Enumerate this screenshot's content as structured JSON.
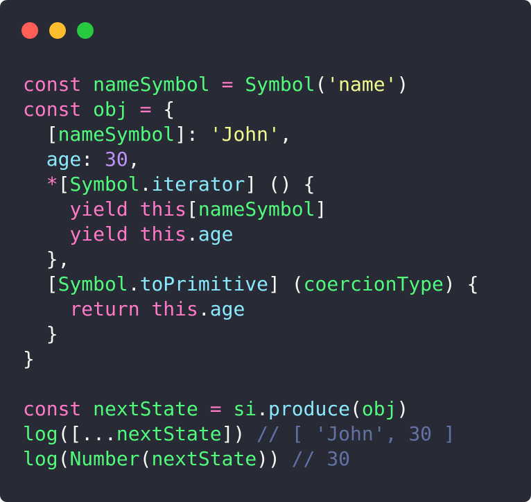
{
  "window": {
    "buttons": [
      {
        "name": "close",
        "color": "#ff5f56"
      },
      {
        "name": "minimize",
        "color": "#ffbd2e"
      },
      {
        "name": "maximize",
        "color": "#27c93f"
      }
    ]
  },
  "colors": {
    "background": "#282a36",
    "plain": "#f8f8f2",
    "keyword": "#ff79c6",
    "function": "#50fa7b",
    "string": "#f1fa8c",
    "property": "#8be9fd",
    "number": "#bd93f9",
    "comment": "#6272a4"
  },
  "code": [
    [
      [
        "keyword",
        "const"
      ],
      [
        "plain",
        " "
      ],
      [
        "function",
        "nameSymbol"
      ],
      [
        "plain",
        " "
      ],
      [
        "keyword",
        "="
      ],
      [
        "plain",
        " "
      ],
      [
        "function",
        "Symbol"
      ],
      [
        "plain",
        "("
      ],
      [
        "string",
        "'name'"
      ],
      [
        "plain",
        ")"
      ]
    ],
    [
      [
        "keyword",
        "const"
      ],
      [
        "plain",
        " "
      ],
      [
        "function",
        "obj"
      ],
      [
        "plain",
        " "
      ],
      [
        "keyword",
        "="
      ],
      [
        "plain",
        " {"
      ]
    ],
    [
      [
        "plain",
        "  ["
      ],
      [
        "function",
        "nameSymbol"
      ],
      [
        "plain",
        "]: "
      ],
      [
        "string",
        "'John'"
      ],
      [
        "plain",
        ","
      ]
    ],
    [
      [
        "plain",
        "  "
      ],
      [
        "property",
        "age"
      ],
      [
        "plain",
        ": "
      ],
      [
        "number",
        "30"
      ],
      [
        "plain",
        ","
      ]
    ],
    [
      [
        "plain",
        "  "
      ],
      [
        "keyword",
        "*"
      ],
      [
        "plain",
        "["
      ],
      [
        "function",
        "Symbol"
      ],
      [
        "plain",
        "."
      ],
      [
        "property",
        "iterator"
      ],
      [
        "plain",
        "] () {"
      ]
    ],
    [
      [
        "plain",
        "    "
      ],
      [
        "keyword",
        "yield"
      ],
      [
        "plain",
        " "
      ],
      [
        "keyword",
        "this"
      ],
      [
        "plain",
        "["
      ],
      [
        "function",
        "nameSymbol"
      ],
      [
        "plain",
        "]"
      ]
    ],
    [
      [
        "plain",
        "    "
      ],
      [
        "keyword",
        "yield"
      ],
      [
        "plain",
        " "
      ],
      [
        "keyword",
        "this"
      ],
      [
        "plain",
        "."
      ],
      [
        "property",
        "age"
      ]
    ],
    [
      [
        "plain",
        "  },"
      ]
    ],
    [
      [
        "plain",
        "  ["
      ],
      [
        "function",
        "Symbol"
      ],
      [
        "plain",
        "."
      ],
      [
        "property",
        "toPrimitive"
      ],
      [
        "plain",
        "] ("
      ],
      [
        "function",
        "coercionType"
      ],
      [
        "plain",
        ") {"
      ]
    ],
    [
      [
        "plain",
        "    "
      ],
      [
        "keyword",
        "return"
      ],
      [
        "plain",
        " "
      ],
      [
        "keyword",
        "this"
      ],
      [
        "plain",
        "."
      ],
      [
        "property",
        "age"
      ]
    ],
    [
      [
        "plain",
        "  }"
      ]
    ],
    [
      [
        "plain",
        "}"
      ]
    ],
    [],
    [
      [
        "keyword",
        "const"
      ],
      [
        "plain",
        " "
      ],
      [
        "function",
        "nextState"
      ],
      [
        "plain",
        " "
      ],
      [
        "keyword",
        "="
      ],
      [
        "plain",
        " "
      ],
      [
        "function",
        "si"
      ],
      [
        "plain",
        "."
      ],
      [
        "property",
        "produce"
      ],
      [
        "plain",
        "("
      ],
      [
        "function",
        "obj"
      ],
      [
        "plain",
        ")"
      ]
    ],
    [
      [
        "function",
        "log"
      ],
      [
        "plain",
        "([..."
      ],
      [
        "function",
        "nextState"
      ],
      [
        "plain",
        "]) "
      ],
      [
        "comment",
        "// [ 'John', 30 ]"
      ]
    ],
    [
      [
        "function",
        "log"
      ],
      [
        "plain",
        "("
      ],
      [
        "function",
        "Number"
      ],
      [
        "plain",
        "("
      ],
      [
        "function",
        "nextState"
      ],
      [
        "plain",
        "))"
      ],
      [
        "plain",
        " "
      ],
      [
        "comment",
        "// 30"
      ]
    ]
  ]
}
